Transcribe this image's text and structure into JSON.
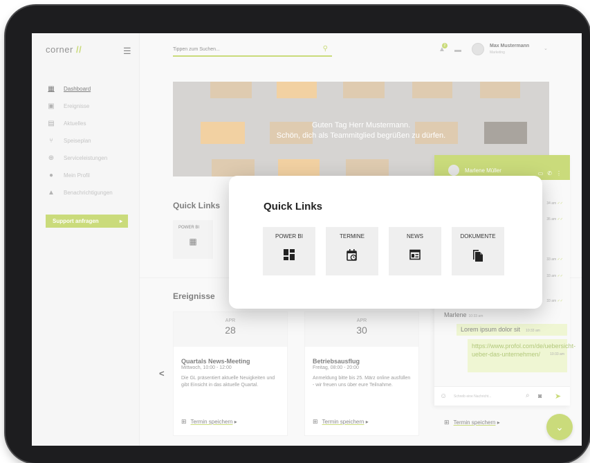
{
  "brand": {
    "logo_text": "corner",
    "logo_mark": "//"
  },
  "sidebar": {
    "items": [
      {
        "label": "Dashboard",
        "icon": "dashboard-icon",
        "active": true
      },
      {
        "label": "Ereignisse",
        "icon": "calendar-clock-icon",
        "active": false
      },
      {
        "label": "Aktuelles",
        "icon": "news-icon",
        "active": false
      },
      {
        "label": "Speiseplan",
        "icon": "restaurant-icon",
        "active": false
      },
      {
        "label": "Serviceleistungen",
        "icon": "globe-icon",
        "active": false
      },
      {
        "label": "Mein Profil",
        "icon": "person-icon",
        "active": false
      },
      {
        "label": "Benachrichtigungen",
        "icon": "bell-icon",
        "active": false
      }
    ],
    "support_label": "Support anfragen"
  },
  "header": {
    "search_placeholder": "Tippen zum Suchen...",
    "notification_count": "2",
    "user_name": "Max Mustermann",
    "user_role": "Marketing"
  },
  "hero": {
    "line1": "Guten Tag Herr Mustermann.",
    "line2": "Schön, dich als Teammitglied begrüßen zu dürfen."
  },
  "quick_links": {
    "title": "Quick Links",
    "items": [
      {
        "label": "POWER BI",
        "icon": "dashboard-icon"
      },
      {
        "label": "TERMINE",
        "icon": "calendar-clock-icon"
      },
      {
        "label": "NEWS",
        "icon": "news-icon"
      },
      {
        "label": "DOKUMENTE",
        "icon": "document-icon"
      }
    ]
  },
  "events": {
    "title": "Ereignisse",
    "save_label": "Termin speichern",
    "cards": [
      {
        "month": "APR",
        "day": "28",
        "title": "Quartals News-Meeting",
        "time": "Mittwoch, 10:00 - 12:00",
        "desc": "Die GL präsentiert aktuelle Neuigkeiten und gibt Einsicht in das aktuelle Quartal."
      },
      {
        "month": "APR",
        "day": "30",
        "title": "Betriebsausflug",
        "time": "Freitag, 08:00 - 20:00",
        "desc": "Anmeldung bitte bis 25. März online ausfüllen - wir freuen uns über eure Teilnahme."
      }
    ]
  },
  "chat": {
    "contact": "Marlene Müller",
    "stamps": [
      "34 am",
      "35 am",
      "33 am",
      "33 am",
      "33 am"
    ],
    "sender": "Marlene",
    "sender_time": "10:33 am",
    "message1": "Lorem ipsum dolor sit",
    "message1_time": "10:33 am",
    "message2": "https://www.profol.com/de/uebersicht-ueber-das-unternehmen/",
    "message2_time": "10:33 am",
    "input_placeholder": "Schreib eine Nachricht...",
    "extra_save_label": "Termin speichern"
  },
  "colors": {
    "accent": "#a4c21c",
    "modal_bg": "#ffffff",
    "tile_bg": "#efefef"
  }
}
